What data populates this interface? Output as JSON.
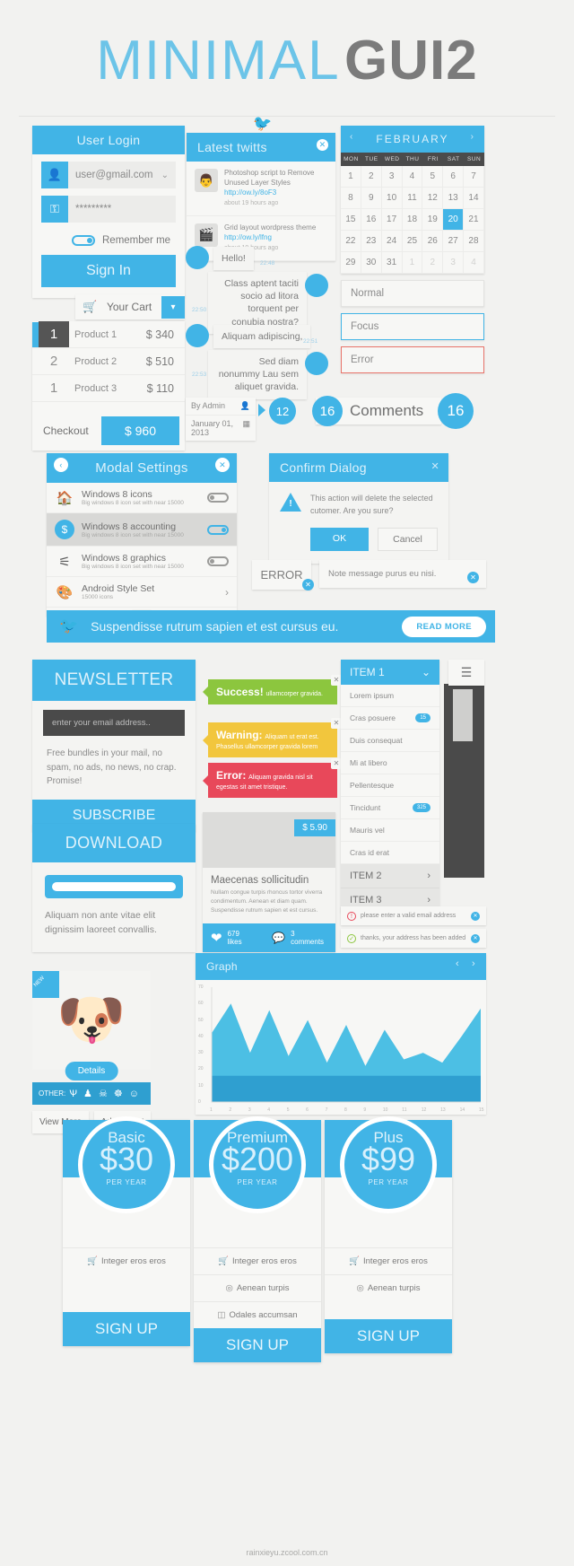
{
  "masthead": {
    "title1": "MINIMAL",
    "title2": "GUI2"
  },
  "login": {
    "title": "User Login",
    "email": "user@gmail.com",
    "password": "*********",
    "remember": "Remember me",
    "signin": "Sign In",
    "user_icon": "user-icon",
    "key_icon": "key-icon",
    "chevron": "⌄"
  },
  "cart": {
    "button": "Your Cart",
    "cart_icon": "cart-icon",
    "rows": [
      {
        "qty": "1",
        "name": "Product 1",
        "price": "$ 340"
      },
      {
        "qty": "2",
        "name": "Product 2",
        "price": "$ 510"
      },
      {
        "qty": "1",
        "name": "Product 3",
        "price": "$ 110"
      }
    ],
    "checkout_label": "Checkout",
    "total": "$ 960"
  },
  "twitter": {
    "title": "Latest twitts",
    "close": "✕",
    "tweets": [
      {
        "text": "Photoshop script to Remove Unused Layer Styles",
        "link": "http://ow.ly/8oF3",
        "ago": "about 19 hours ago"
      },
      {
        "text": "Grid layout wordpress theme",
        "link": "http://ow.ly/lfng",
        "ago": "about 19 hours ago"
      }
    ]
  },
  "chat": {
    "msg1": "Hello!",
    "msg1_time": "22:48",
    "msg2": "Class aptent taciti socio ad litora torquent per conubia nostra?",
    "msg2_time": "22:50",
    "msg3": "Aliquam adipiscing,",
    "msg3_time": "22:51",
    "msg4": "Sed diam nonummy Lau sem aliquet gravida.",
    "msg4_time": "22:53"
  },
  "inputs": {
    "normal": "Normal",
    "focus": "Focus",
    "error": "Error"
  },
  "calendar": {
    "month": "FEBRUARY",
    "prev": "‹",
    "next": "›",
    "dow": [
      "MON",
      "TUE",
      "WED",
      "THU",
      "FRI",
      "SAT",
      "SUN"
    ],
    "days": [
      "1",
      "2",
      "3",
      "4",
      "5",
      "6",
      "7",
      "8",
      "9",
      "10",
      "11",
      "12",
      "13",
      "14",
      "15",
      "16",
      "17",
      "18",
      "19",
      "20",
      "21",
      "22",
      "23",
      "24",
      "25",
      "26",
      "27",
      "28",
      "29",
      "30",
      "31",
      "1",
      "2",
      "3",
      "4"
    ],
    "selected": "20",
    "muted_from_index": 31
  },
  "meta": {
    "author_label": "By Admin",
    "date": "January 01, 2013",
    "count_small": "12",
    "count_left": "16",
    "comments_label": "Comments",
    "count_right": "16"
  },
  "modal": {
    "title": "Modal Settings",
    "back": "‹",
    "close": "✕",
    "rows": [
      {
        "icon": "home-icon",
        "glyph": "⌂",
        "title": "Windows 8 icons",
        "sub": "Big windows 8 icon set with near 15000",
        "toggle": "off"
      },
      {
        "icon": "dollar-icon",
        "glyph": "$",
        "title": "Windows 8 accounting",
        "sub": "Big windows 8 icon set with near 15000",
        "toggle": "on"
      },
      {
        "icon": "graph-icon",
        "glyph": "⎇",
        "title": "Windows 8 graphics",
        "sub": "Big windows 8 icon set with near 15000",
        "toggle": "off"
      },
      {
        "icon": "palette-icon",
        "glyph": "❀",
        "title": "Android Style Set",
        "sub": "15000 icons",
        "toggle": "arrow"
      }
    ]
  },
  "confirm": {
    "title": "Confirm Dialog",
    "close": "✕",
    "body": "This action will delete the selected cutomer. Are you sure?",
    "ok": "OK",
    "cancel": "Cancel",
    "warn_glyph": "!"
  },
  "errorbox": {
    "label": "ERROR",
    "note": "Note message purus eu nisi."
  },
  "ribbon": {
    "text": "Suspendisse rutrum sapien et est cursus eu.",
    "button": "READ MORE",
    "bird_icon": "twitter-bird-icon"
  },
  "newsletter": {
    "title": "NEWSLETTER",
    "placeholder": "enter your email address..",
    "text": "Free bundles in your mail, no spam, no ads, no news, no crap. Promise!",
    "subscribe": "SUBSCRIBE"
  },
  "alerts": [
    {
      "kind": "success",
      "bold": "Success!",
      "text": "ullamcorper gravida."
    },
    {
      "kind": "warning",
      "bold": "Warning:",
      "text": "Aliquam ut erat est. Phasellus ullamcorper gravida lorem"
    },
    {
      "kind": "error",
      "bold": "Error:",
      "text": "Aliquam gravida nisl sit egestas sit amet tristique."
    }
  ],
  "listmenu": {
    "header": "ITEM 1",
    "chevron": "⌄",
    "hamburger": "☰",
    "items": [
      {
        "label": "Lorem ipsum",
        "badge": ""
      },
      {
        "label": "Cras posuere",
        "badge": "15"
      },
      {
        "label": "Duis consequat",
        "badge": ""
      },
      {
        "label": "Mi at libero",
        "badge": ""
      },
      {
        "label": "Pellentesque",
        "badge": ""
      },
      {
        "label": "Tincidunt",
        "badge": "325"
      },
      {
        "label": "Mauris vel",
        "badge": ""
      },
      {
        "label": "Cras id erat",
        "badge": ""
      }
    ],
    "sections": [
      {
        "label": "ITEM 2",
        "arrow": "›"
      },
      {
        "label": "ITEM 3",
        "arrow": "›"
      }
    ]
  },
  "download": {
    "title": "DOWNLOAD",
    "text": "Aliquam non ante vitae elit dignissim laoreet convallis."
  },
  "media": {
    "price": "$ 5.90",
    "heading": "Maecenas sollicitudin",
    "body": "Nullam congue turpis rhoncus tortor viverra condimentum. Aenean et diam quam. Suspendisse rutrum sapien et est cursus.",
    "likes": "679 likes",
    "comments": "3 comments",
    "heart_icon": "heart-icon",
    "comment_icon": "comment-icon"
  },
  "notices": [
    {
      "text": "please enter a valid email address",
      "kind": "error",
      "glyph": "!"
    },
    {
      "text": "thanks, your address has been added",
      "kind": "success",
      "glyph": "✓"
    }
  ],
  "product": {
    "flag": "NEW",
    "details": "Details",
    "other_label": "OTHER:",
    "other_icons": "Ѱ ♟ ☠ ☸ ☺",
    "view_more": "View More",
    "add_to_cart": "Add to cart",
    "dog_icon": "dog-avatar-icon"
  },
  "chart_data": {
    "type": "area",
    "title": "Graph",
    "prev": "‹",
    "next": "›",
    "x": [
      1,
      2,
      3,
      4,
      5,
      6,
      7,
      8,
      9,
      10,
      11,
      12,
      13,
      14,
      15
    ],
    "series": [
      {
        "name": "upper",
        "values": [
          42,
          60,
          30,
          56,
          28,
          50,
          24,
          47,
          22,
          44,
          26,
          30,
          24,
          40,
          57
        ]
      },
      {
        "name": "lower",
        "values": [
          16,
          16,
          16,
          16,
          16,
          16,
          16,
          16,
          16,
          16,
          16,
          16,
          16,
          16,
          16
        ]
      }
    ],
    "ytick_labels": [
      "0",
      "10",
      "20",
      "30",
      "40",
      "50",
      "60",
      "70"
    ],
    "ylim": [
      0,
      70
    ],
    "xlabel": "",
    "ylabel": "",
    "grid": false,
    "legend": "none"
  },
  "pricing": [
    {
      "name": "Basic",
      "amount": "$30",
      "per": "PER YEAR",
      "signup": "SIGN UP",
      "features": [
        {
          "icon": "cart-icon",
          "glyph": "🛒",
          "label": "Integer eros eros"
        }
      ]
    },
    {
      "name": "Premium",
      "amount": "$200",
      "per": "PER YEAR",
      "signup": "SIGN UP",
      "features": [
        {
          "icon": "cart-icon",
          "glyph": "🛒",
          "label": "Integer eros eros"
        },
        {
          "icon": "pin-icon",
          "glyph": "☉",
          "label": "Aenean turpis"
        },
        {
          "icon": "box-icon",
          "glyph": "▭",
          "label": "Odales accumsan"
        }
      ]
    },
    {
      "name": "Plus",
      "amount": "$99",
      "per": "PER YEAR",
      "signup": "SIGN UP",
      "features": [
        {
          "icon": "cart-icon",
          "glyph": "🛒",
          "label": "Integer eros eros"
        },
        {
          "icon": "pin-icon",
          "glyph": "☉",
          "label": "Aenean turpis"
        }
      ]
    }
  ],
  "footer": "rainxieyu.zcool.com.cn",
  "colors": {
    "accent": "#41b4e6",
    "dark": "#4a4a4a",
    "success": "#8cc63e",
    "warning": "#f2c63d",
    "error": "#e8485a"
  }
}
